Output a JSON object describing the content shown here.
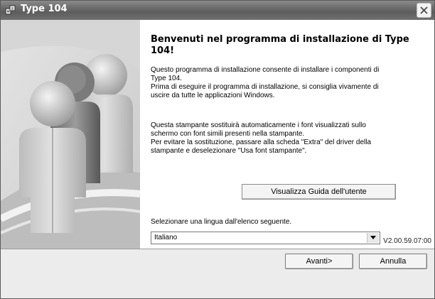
{
  "window": {
    "title": "Type 104"
  },
  "icons": {
    "title": "installer-icon",
    "close": "close-icon",
    "dropdown": "chevron-down-icon",
    "art": "users-illustration"
  },
  "content": {
    "heading": "Benvenuti nel programma di installazione di Type 104!",
    "paragraph1": [
      "Questo programma di installazione consente di installare i componenti di",
      "Type 104.",
      "Prima di eseguire il programma di installazione, si consiglia vivamente di",
      "uscire da tutte le applicazioni Windows."
    ],
    "paragraph2": [
      "Questa stampante sostituirà automaticamente i font visualizzati sullo",
      "schermo con font simili presenti nella stampante.",
      "Per evitare la sostituzione, passare alla scheda \"Extra\" del driver della",
      "stampante e deselezionare \"Usa font stampante\"."
    ],
    "guide_button": "Visualizza Guida dell'utente",
    "language_label": "Selezionare una lingua dall'elenco seguente.",
    "language_selected": "Italiano",
    "version": "V2.00.59.07:00"
  },
  "footer": {
    "next_label": "Avanti>",
    "cancel_label": "Annulla"
  },
  "colors": {
    "titlebar": "#6a6a6a",
    "window_bg": "#ececec",
    "content_bg": "#ffffff"
  }
}
